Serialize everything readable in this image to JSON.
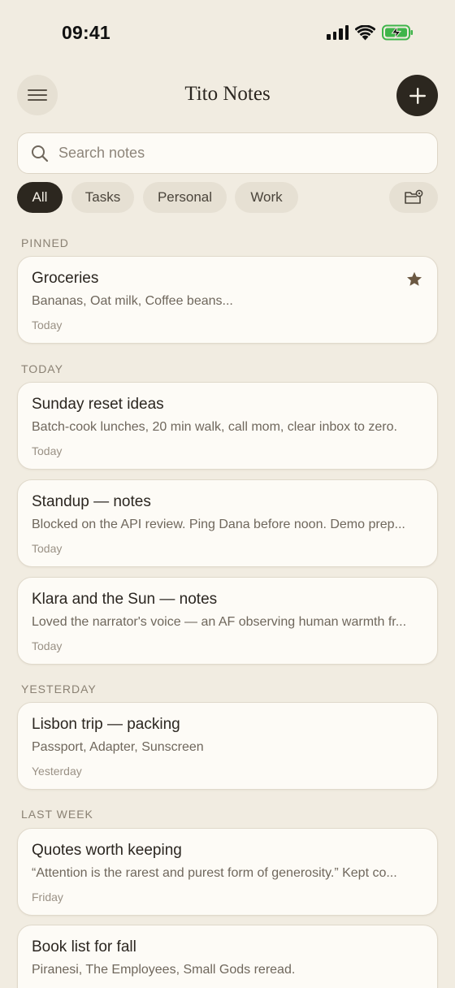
{
  "status_bar": {
    "time": "09:41"
  },
  "header": {
    "title": "Tito Notes"
  },
  "search": {
    "placeholder": "Search notes",
    "value": ""
  },
  "filters": [
    {
      "label": "All",
      "active": true
    },
    {
      "label": "Tasks",
      "active": false
    },
    {
      "label": "Personal",
      "active": false
    },
    {
      "label": "Work",
      "active": false
    }
  ],
  "sections": {
    "pinned": "PINNED",
    "today": "TODAY",
    "yesterday": "YESTERDAY",
    "last_week": "LAST WEEK"
  },
  "notes": [
    {
      "title": "Groceries",
      "preview": "Bananas, Oat milk, Coffee beans...",
      "date": "Today",
      "starred": true
    },
    {
      "title": "Sunday reset ideas",
      "preview": "Batch-cook lunches, 20 min walk, call mom, clear inbox to zero.",
      "date": "Today"
    },
    {
      "title": "Standup — notes",
      "preview": "Blocked on the API review. Ping Dana before noon. Demo prep...",
      "date": "Today"
    },
    {
      "title": "Klara and the Sun — notes",
      "preview": "Loved the narrator's voice — an AF observing human warmth fr...",
      "date": "Today"
    },
    {
      "title": "Lisbon trip — packing",
      "preview": "Passport, Adapter, Sunscreen",
      "date": "Yesterday"
    },
    {
      "title": "Quotes worth keeping",
      "preview": "“Attention is the rarest and purest form of generosity.” Kept co...",
      "date": "Friday"
    },
    {
      "title": "Book list for fall",
      "preview": "Piranesi, The Employees, Small Gods reread.",
      "date": ""
    }
  ],
  "colors": {
    "background": "#f1ece1",
    "accent_dark": "#2c271f",
    "card": "#fdfbf6",
    "star": "#6b5842"
  },
  "icons": {
    "menu": "hamburger-icon",
    "add": "plus-icon",
    "search": "search-icon",
    "folder": "folder-settings-icon",
    "star": "star-icon"
  }
}
